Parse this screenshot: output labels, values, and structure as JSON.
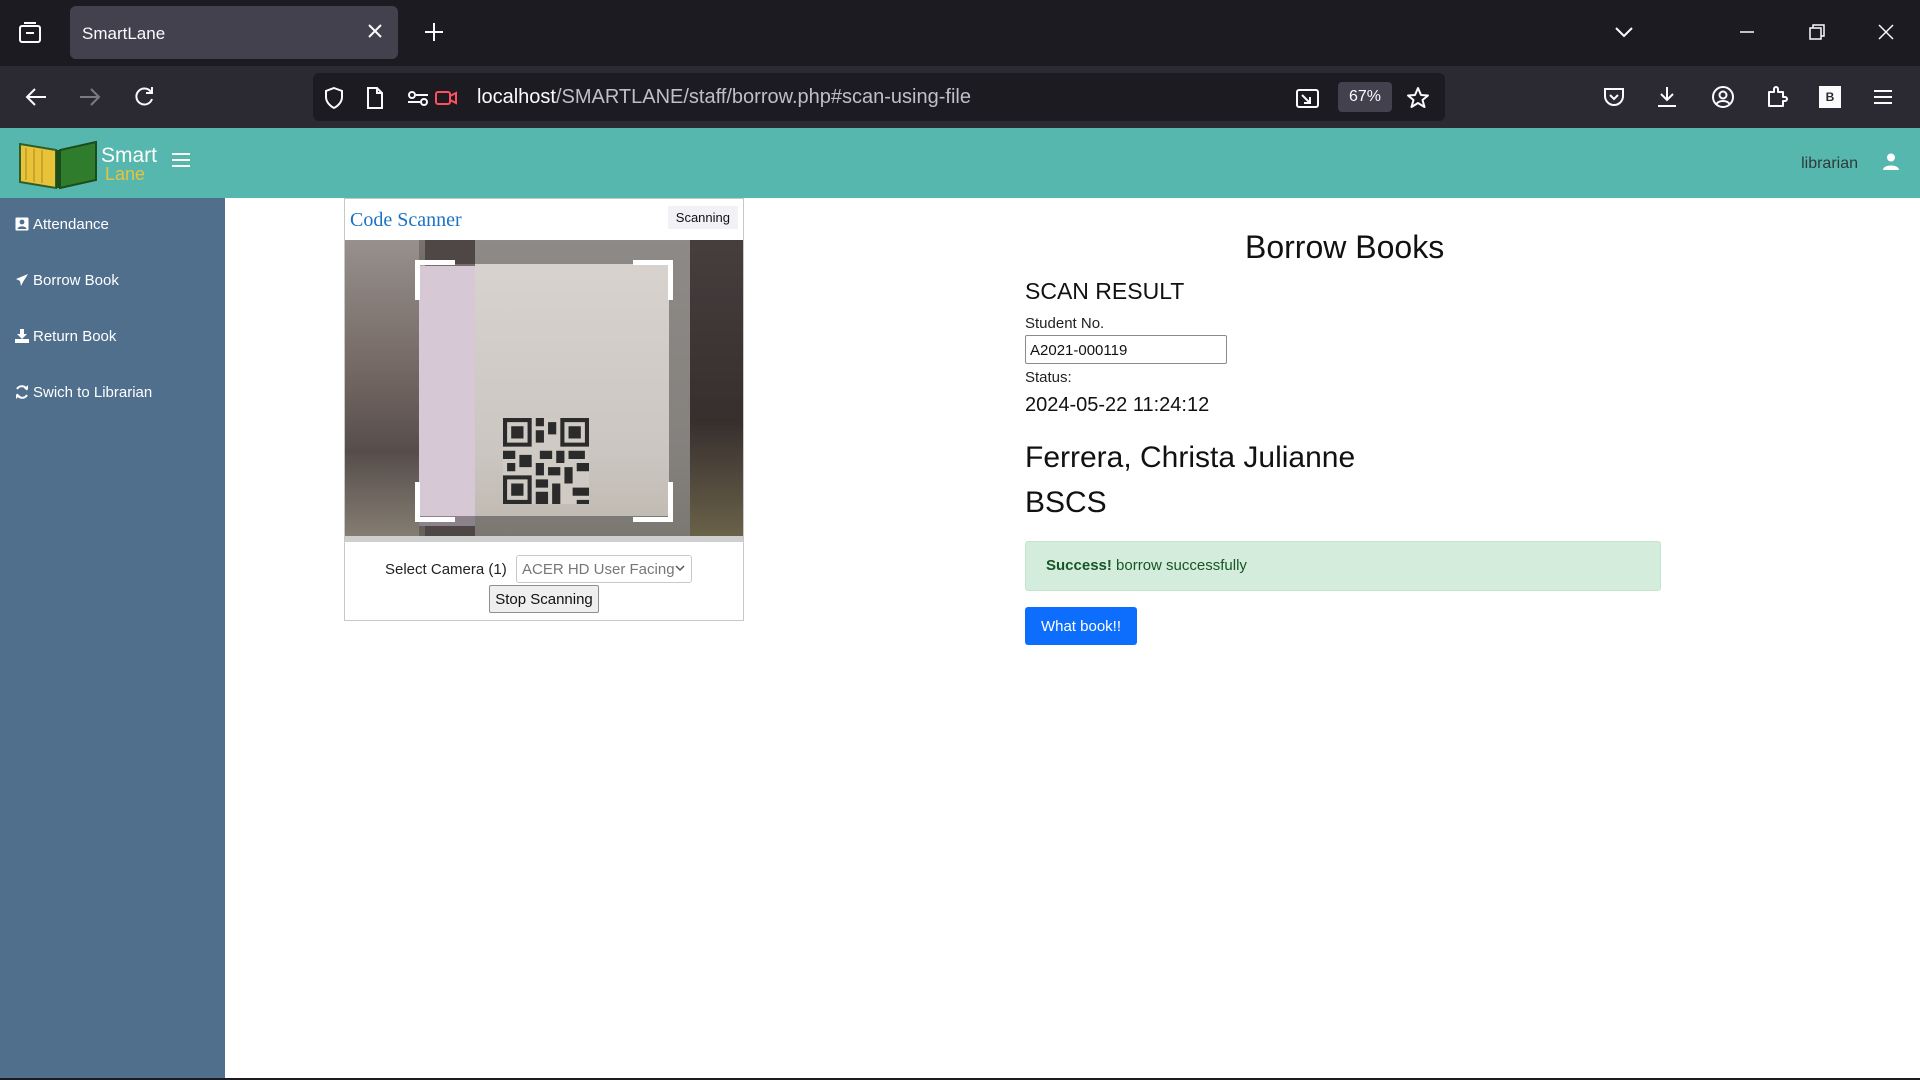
{
  "browser": {
    "tab_title": "SmartLane",
    "url_host": "localhost",
    "url_path": "/SMARTLANE/staff/borrow.php#scan-using-file",
    "zoom": "67%"
  },
  "app": {
    "logo_word1": "Smart",
    "logo_word2": "Lane",
    "user": "librarian",
    "colors": {
      "header": "#55b7ae",
      "sidebar": "#4f6f8c",
      "primary_button": "#0d6efd"
    }
  },
  "sidebar": {
    "items": [
      {
        "label": "Attendance",
        "icon": "user-check-icon"
      },
      {
        "label": "Borrow Book",
        "icon": "send-icon"
      },
      {
        "label": "Return Book",
        "icon": "download-icon"
      },
      {
        "label": "Swich to Librarian",
        "icon": "refresh-icon"
      }
    ]
  },
  "scanner": {
    "title": "Code Scanner",
    "status": "Scanning",
    "camera_label": "Select Camera (1)",
    "camera_selected": "ACER HD User Facing",
    "stop_label": "Stop Scanning"
  },
  "result": {
    "page_title": "Borrow Books",
    "heading": "SCAN RESULT",
    "student_label": "Student No.",
    "student_no": "A2021-000119",
    "status_label": "Status:",
    "status_value": "2024-05-22 11:24:12",
    "name": "Ferrera, Christa Julianne",
    "course": "BSCS",
    "alert_strong": "Success!",
    "alert_text": " borrow successfully",
    "button_label": "What book!!"
  }
}
